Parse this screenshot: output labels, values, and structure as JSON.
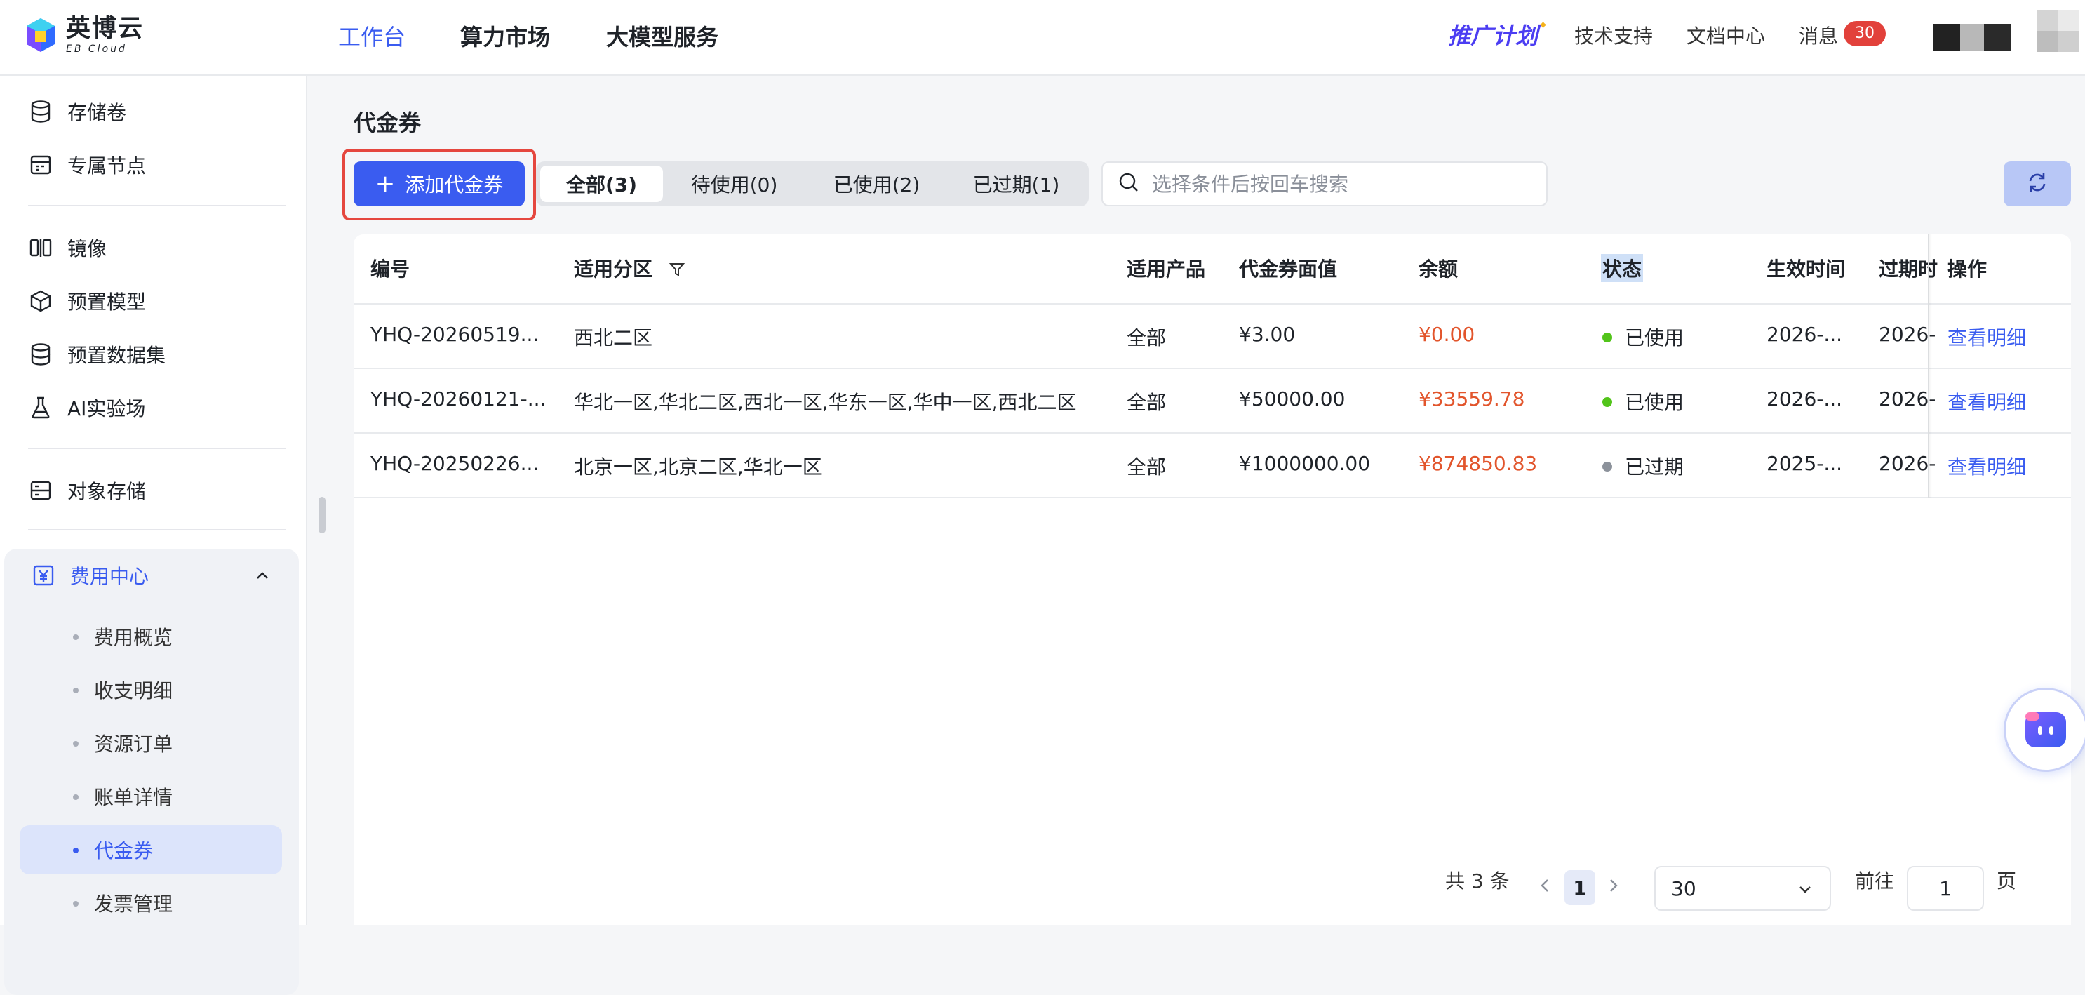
{
  "brand": {
    "name_cn": "英博云",
    "name_en": "EB Cloud",
    "colors": {
      "accent": "#3a5cf0",
      "danger": "#e2552c",
      "success": "#52c41a",
      "muted": "#8c929b"
    }
  },
  "topnav": {
    "items": [
      {
        "label": "工作台",
        "active": true
      },
      {
        "label": "算力市场"
      },
      {
        "label": "大模型服务"
      }
    ],
    "promo": "推广计划",
    "links": {
      "support": "技术支持",
      "docs": "文档中心",
      "messages": "消息"
    },
    "message_count": "30"
  },
  "sidebar": {
    "items": [
      {
        "label": "存储卷",
        "icon": "database-icon"
      },
      {
        "label": "专属节点",
        "icon": "calendar-grid-icon"
      },
      {
        "label": "镜像",
        "icon": "mirror-icon"
      },
      {
        "label": "预置模型",
        "icon": "cube-icon"
      },
      {
        "label": "预置数据集",
        "icon": "database-icon"
      },
      {
        "label": "AI实验场",
        "icon": "flask-icon"
      },
      {
        "label": "对象存储",
        "icon": "storage-icon"
      }
    ],
    "group": {
      "label": "费用中心",
      "icon": "yen-icon",
      "children": [
        "费用概览",
        "收支明细",
        "资源订单",
        "账单详情",
        "代金券",
        "发票管理"
      ],
      "active_child": "代金券"
    }
  },
  "page": {
    "title": "代金券"
  },
  "toolbar": {
    "add_label": "添加代金券",
    "tabs": [
      "全部(3)",
      "待使用(0)",
      "已使用(2)",
      "已过期(1)"
    ],
    "active_tab": "全部(3)",
    "search_placeholder": "选择条件后按回车搜索"
  },
  "table": {
    "headers": [
      "编号",
      "适用分区",
      "适用产品",
      "代金券面值",
      "余额",
      "状态",
      "生效时间",
      "过期时",
      "操作"
    ],
    "rows": [
      {
        "id": "YHQ-20260519...",
        "zones": "西北二区",
        "product": "全部",
        "face": "¥3.00",
        "balance": "¥0.00",
        "status": "已使用",
        "status_color": "#52c41a",
        "start": "2026-...",
        "expire": "2026-",
        "action": "查看明细"
      },
      {
        "id": "YHQ-20260121-...",
        "zones": "华北一区,华北二区,西北一区,华东一区,华中一区,西北二区",
        "product": "全部",
        "face": "¥50000.00",
        "balance": "¥33559.78",
        "status": "已使用",
        "status_color": "#52c41a",
        "start": "2026-...",
        "expire": "2026-",
        "action": "查看明细"
      },
      {
        "id": "YHQ-20250226...",
        "zones": "北京一区,北京二区,华北一区",
        "product": "全部",
        "face": "¥1000000.00",
        "balance": "¥874850.83",
        "status": "已过期",
        "status_color": "#8c929b",
        "start": "2025-...",
        "expire": "2026-",
        "action": "查看明细"
      }
    ]
  },
  "pagination": {
    "total": "共 3 条",
    "current": "1",
    "page_size": "30",
    "goto_label": "前往",
    "goto_value": "1",
    "page_suffix": "页"
  }
}
